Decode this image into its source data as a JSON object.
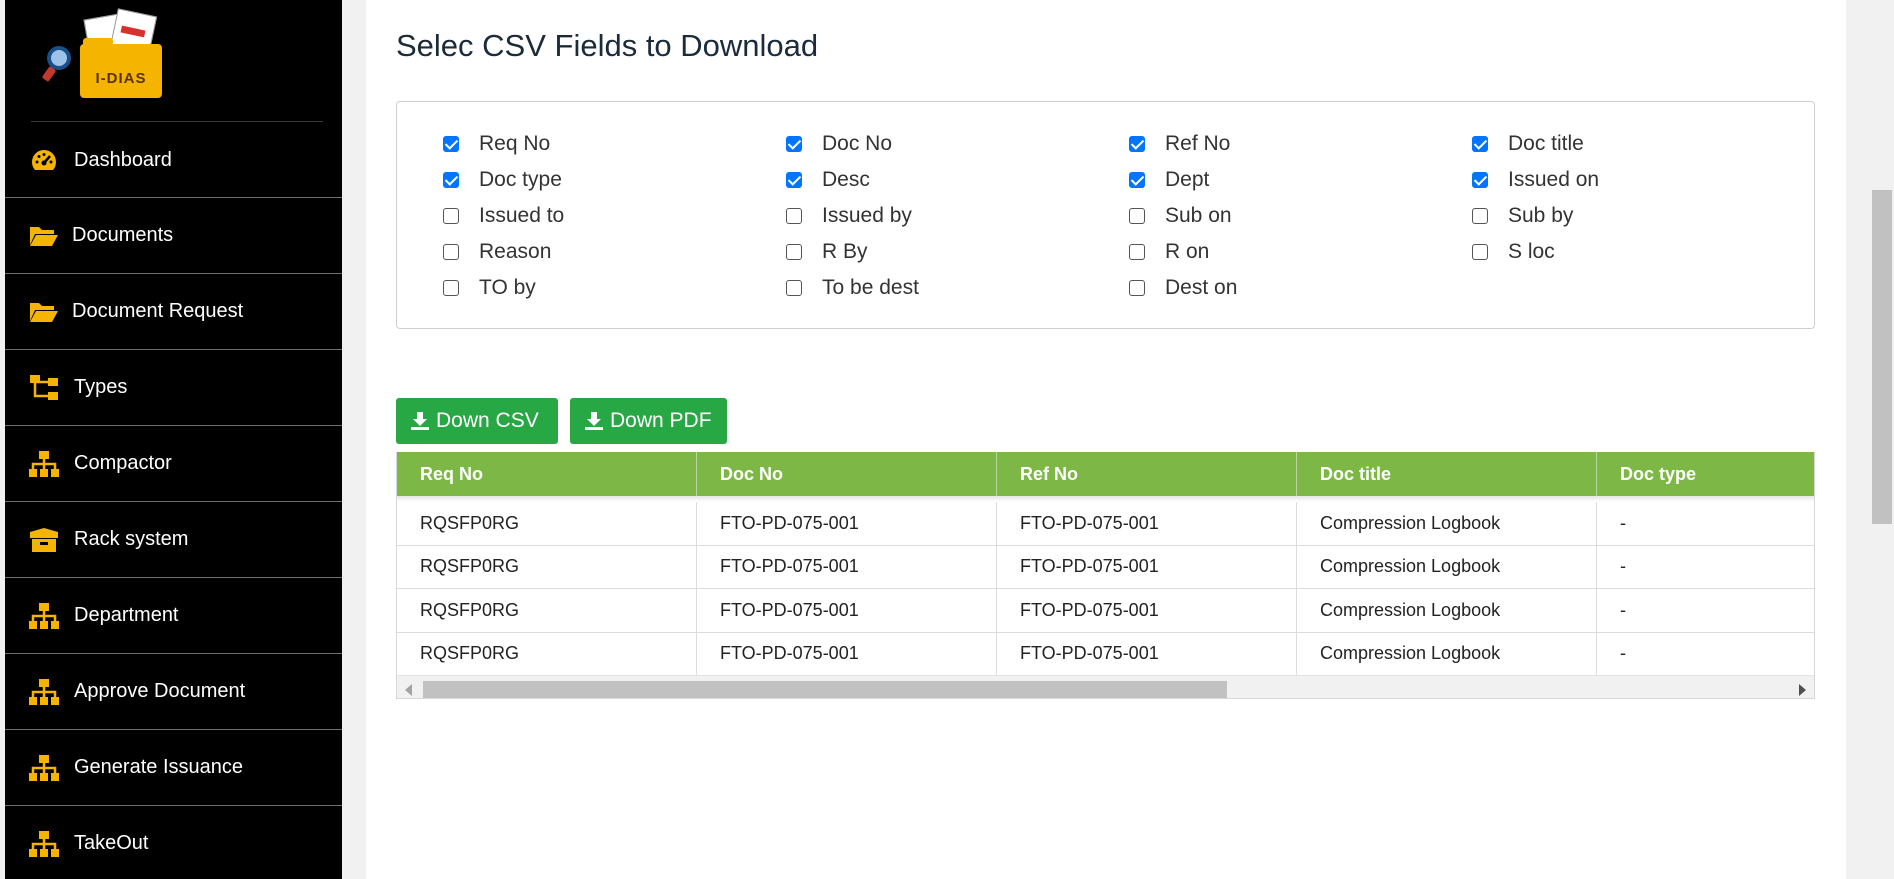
{
  "logo": {
    "text": "I-DIAS"
  },
  "sidebar": {
    "items": [
      {
        "label": "Dashboard",
        "icon": "dashboard-gauge-icon"
      },
      {
        "label": "Documents",
        "icon": "folder-open-icon"
      },
      {
        "label": "Document Request",
        "icon": "folder-open-icon"
      },
      {
        "label": "Types",
        "icon": "hierarchy-icon"
      },
      {
        "label": "Compactor",
        "icon": "sitemap-icon"
      },
      {
        "label": "Rack system",
        "icon": "box-icon"
      },
      {
        "label": "Department",
        "icon": "sitemap-icon"
      },
      {
        "label": "Approve Document",
        "icon": "sitemap-icon"
      },
      {
        "label": "Generate Issuance",
        "icon": "sitemap-icon"
      },
      {
        "label": "TakeOut",
        "icon": "sitemap-icon"
      }
    ]
  },
  "main": {
    "title": "Selec CSV Fields to Download",
    "fields": [
      {
        "label": "Req No",
        "checked": true
      },
      {
        "label": "Doc No",
        "checked": true
      },
      {
        "label": "Ref No",
        "checked": true
      },
      {
        "label": "Doc title",
        "checked": true
      },
      {
        "label": "Doc type",
        "checked": true
      },
      {
        "label": "Desc",
        "checked": true
      },
      {
        "label": "Dept",
        "checked": true
      },
      {
        "label": "Issued on",
        "checked": true
      },
      {
        "label": "Issued to",
        "checked": false
      },
      {
        "label": "Issued by",
        "checked": false
      },
      {
        "label": "Sub on",
        "checked": false
      },
      {
        "label": "Sub by",
        "checked": false
      },
      {
        "label": "Reason",
        "checked": false
      },
      {
        "label": "R By",
        "checked": false
      },
      {
        "label": "R on",
        "checked": false
      },
      {
        "label": "S loc",
        "checked": false
      },
      {
        "label": "TO by",
        "checked": false
      },
      {
        "label": "To be dest",
        "checked": false
      },
      {
        "label": "Dest on",
        "checked": false
      }
    ],
    "buttons": {
      "csv": "Down CSV",
      "pdf": "Down PDF"
    },
    "table": {
      "headers": [
        "Req No",
        "Doc No",
        "Ref No",
        "Doc title",
        "Doc type"
      ],
      "rows": [
        [
          "RQSFP0RG",
          "FTO-PD-075-001",
          "FTO-PD-075-001",
          "Compression Logbook",
          "-"
        ],
        [
          "RQSFP0RG",
          "FTO-PD-075-001",
          "FTO-PD-075-001",
          "Compression Logbook",
          "-"
        ],
        [
          "RQSFP0RG",
          "FTO-PD-075-001",
          "FTO-PD-075-001",
          "Compression Logbook",
          "-"
        ],
        [
          "RQSFP0RG",
          "FTO-PD-075-001",
          "FTO-PD-075-001",
          "Compression Logbook",
          "-"
        ]
      ]
    }
  },
  "colors": {
    "sidebar_bg": "#000000",
    "icon": "#f4b400",
    "button": "#28a745",
    "table_header": "#7db846",
    "checkbox": "#0075ff"
  }
}
